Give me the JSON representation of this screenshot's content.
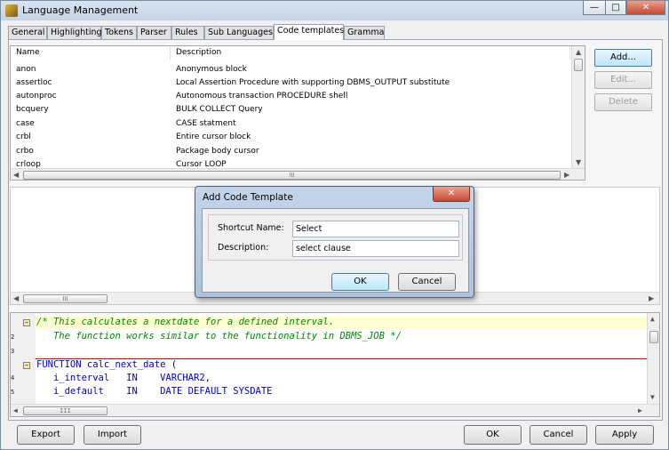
{
  "window": {
    "title": "Language Management",
    "controls": {
      "minimize": "—",
      "maximize": "□",
      "close": "✕"
    }
  },
  "tabs": [
    {
      "label": "General"
    },
    {
      "label": "Highlighting"
    },
    {
      "label": "Tokens"
    },
    {
      "label": "Parser"
    },
    {
      "label": "Rules"
    },
    {
      "label": "Sub Languages"
    },
    {
      "label": "Code templates"
    },
    {
      "label": "Gramma"
    }
  ],
  "active_tab": "Code templates",
  "templates_grid": {
    "columns": [
      "Name",
      "Description"
    ],
    "rows": [
      {
        "name": "anon",
        "description": "Anonymous block"
      },
      {
        "name": "assertloc",
        "description": "Local Assertion Procedure with supporting DBMS_OUTPUT substitute"
      },
      {
        "name": "autonproc",
        "description": "Autonomous transaction PROCEDURE shell"
      },
      {
        "name": "bcquery",
        "description": "BULK COLLECT Query"
      },
      {
        "name": "case",
        "description": "CASE statment"
      },
      {
        "name": "crbl",
        "description": "Entire cursor block"
      },
      {
        "name": "crbo",
        "description": "Package body cursor"
      },
      {
        "name": "crloop",
        "description": "Cursor LOOP"
      }
    ]
  },
  "side_buttons": {
    "add": "Add...",
    "edit": "Edit...",
    "delete": "Delete"
  },
  "scroll_glyph": "III",
  "editor": {
    "line_numbers": [
      "",
      "2",
      "",
      "3",
      "4",
      "5",
      "6"
    ],
    "lines": [
      "/* This calculates a nextdate for a defined interval.",
      "   The function works similar to the functionality in DBMS_JOB */",
      "",
      "FUNCTION calc_next_date (",
      "   i_interval   IN    VARCHAR2,",
      "   i_default    IN    DATE DEFAULT SYSDATE"
    ],
    "colors": {
      "comment": "#008a00",
      "keyword": "#0000c8",
      "separator": "#c00000"
    }
  },
  "bottom_buttons": {
    "export": "Export",
    "import": "Import",
    "ok": "OK",
    "cancel": "Cancel",
    "apply": "Apply"
  },
  "dialog": {
    "title": "Add Code Template",
    "shortcut_label": "Shortcut Name:",
    "shortcut_value": "Select",
    "description_label": "Description:",
    "description_value": "select clause",
    "ok": "OK",
    "cancel": "Cancel",
    "close": "✕"
  }
}
